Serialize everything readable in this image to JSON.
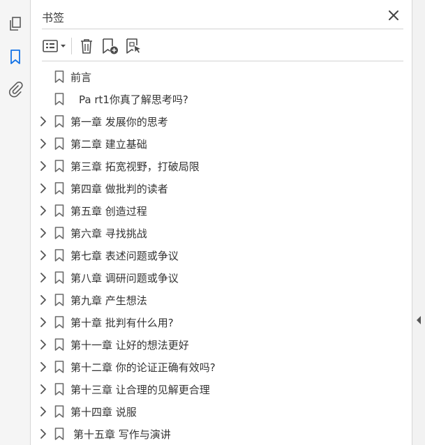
{
  "panel": {
    "title": "书签"
  },
  "rail": {
    "icons": [
      "pages-icon",
      "bookmark-icon",
      "attachment-icon"
    ]
  },
  "toolbar": {
    "icons": [
      "options-menu-icon",
      "delete-icon",
      "new-bookmark-icon",
      "new-bookmark-from-selection-icon"
    ]
  },
  "bookmarks": [
    {
      "label": "前言",
      "expandable": false
    },
    {
      "label": "Pa rt1你真了解思考吗?",
      "expandable": false
    },
    {
      "label": "第一章 发展你的思考",
      "expandable": true
    },
    {
      "label": "第二章 建立基础",
      "expandable": true
    },
    {
      "label": "第三章 拓宽视野，打破局限",
      "expandable": true
    },
    {
      "label": "第四章 做批判的读者",
      "expandable": true
    },
    {
      "label": "第五章 创造过程",
      "expandable": true
    },
    {
      "label": "第六章 寻找挑战",
      "expandable": true
    },
    {
      "label": "第七章 表述问题或争议",
      "expandable": true
    },
    {
      "label": "第八章 调研问题或争议",
      "expandable": true
    },
    {
      "label": "第九章 产生想法",
      "expandable": true
    },
    {
      "label": "第十章 批判有什么用?",
      "expandable": true
    },
    {
      "label": "第十一章 让好的想法更好",
      "expandable": true
    },
    {
      "label": "第十二章 你的论证正确有效吗?",
      "expandable": true
    },
    {
      "label": "第十三章 让合理的见解更合理",
      "expandable": true
    },
    {
      "label": "第十四章 说服",
      "expandable": true
    },
    {
      "label": "第十五章 写作与演讲",
      "expandable": true
    }
  ],
  "colors": {
    "accent": "#1473e6",
    "icon": "#5a5a5a",
    "text": "#333333"
  }
}
